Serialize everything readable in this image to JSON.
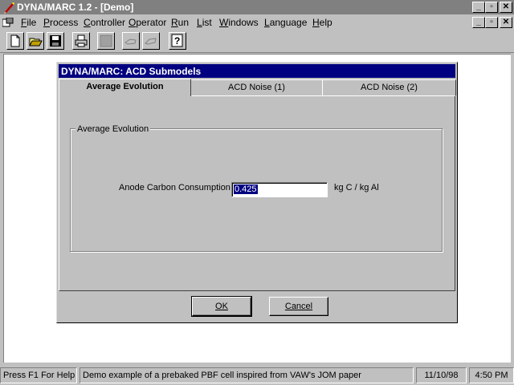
{
  "window": {
    "title": "DYNA/MARC 1.2 - [Demo]",
    "minimize": "_",
    "restore": "▫",
    "close": "✕"
  },
  "menu": [
    {
      "label": "File",
      "mnemonic": "F"
    },
    {
      "label": "Process",
      "mnemonic": "P"
    },
    {
      "label": "Controller",
      "mnemonic": "C"
    },
    {
      "label": "Operator",
      "mnemonic": "O"
    },
    {
      "label": "Run",
      "mnemonic": "R"
    },
    {
      "label": "List",
      "mnemonic": "L"
    },
    {
      "label": "Windows",
      "mnemonic": "W"
    },
    {
      "label": "Language",
      "mnemonic": "L"
    },
    {
      "label": "Help",
      "mnemonic": "H"
    }
  ],
  "toolbar": {
    "icons": [
      "new-document-icon",
      "open-folder-icon",
      "save-icon",
      "print-icon",
      "blank-disabled-icon",
      "disabled-hand-icon",
      "disabled-hand-icon",
      "help-icon"
    ]
  },
  "dialog": {
    "title": "DYNA/MARC: ACD Submodels",
    "tabs": [
      {
        "label": "Average Evolution",
        "active": true
      },
      {
        "label": "ACD Noise (1)",
        "active": false
      },
      {
        "label": "ACD Noise (2)",
        "active": false
      }
    ],
    "group_label": "Average Evolution",
    "field": {
      "label": "Anode Carbon Consumption",
      "value": "0.425",
      "unit": "kg C / kg Al"
    },
    "ok_label": "OK",
    "cancel_label": "Cancel"
  },
  "statusbar": {
    "help": "Press F1 For Help",
    "message": "Demo example of a prebaked PBF cell inspired from VAW's JOM paper",
    "date": "11/10/98",
    "time": "4:50 PM"
  },
  "colors": {
    "dialog_title_bg": "#000080",
    "inactive_title_bg": "#808080",
    "face": "#c0c0c0",
    "selection": "#000080"
  }
}
